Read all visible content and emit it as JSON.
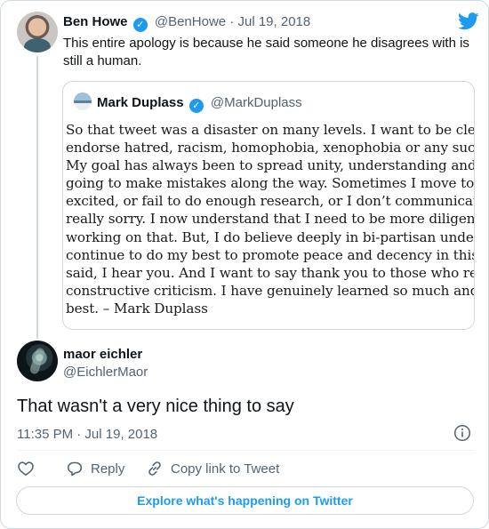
{
  "parent_tweet": {
    "name": "Ben Howe",
    "handle": "@BenHowe",
    "separator": "·",
    "date": "Jul 19, 2018",
    "text": "This entire apology is because he said someone he disagrees with is still a human."
  },
  "quoted_tweet": {
    "name": "Mark Duplass",
    "handle": "@MarkDuplass",
    "image_lines": [
      "So that tweet was a disaster on many levels. I want to be clea",
      "endorse hatred, racism, homophobia, xenophobia or any suc",
      "My goal has always been to spread unity, understanding and",
      "going to make mistakes along the way. Sometimes I move to",
      "excited, or fail to do enough research, or I don’t communicat",
      "really sorry. I now understand that I need to be more diligen",
      "working on that. But, I do believe deeply in bi-partisan unde",
      "continue to do my best to promote peace and decency in this",
      "said, I hear you. And I want to say thank you to those who re",
      "constructive criticism. I have genuinely learned so much and",
      "best. – Mark Duplass"
    ]
  },
  "reply_tweet": {
    "name": "maor eichler",
    "handle": "@EichlerMaor",
    "text": "That wasn't a very nice thing to say",
    "timestamp": "11:35 PM · Jul 19, 2018"
  },
  "actions": {
    "like_label": "",
    "reply_label": "Reply",
    "copy_link_label": "Copy link to Tweet"
  },
  "explore_label": "Explore what's happening on Twitter",
  "colors": {
    "accent": "#1d9bf0",
    "text": "#0f1419",
    "secondary": "#536471",
    "border": "#cfd9de"
  }
}
